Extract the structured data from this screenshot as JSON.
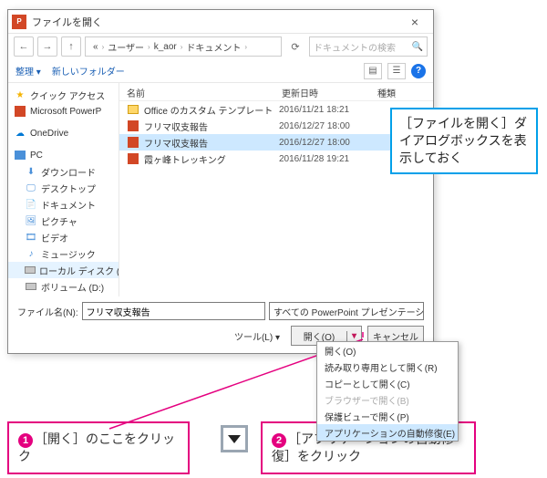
{
  "dialog": {
    "title": "ファイルを開く",
    "close_x": "×",
    "nav": {
      "back": "←",
      "fwd": "→",
      "up": "↑",
      "refresh": "⟳",
      "breadcrumb": [
        "«",
        "ユーザー",
        "k_aor",
        "ドキュメント"
      ],
      "search_placeholder": "ドキュメントの検索",
      "search_icon": "🔍"
    },
    "toolbar": {
      "organize": "整理 ▾",
      "newfolder": "新しいフォルダー",
      "help": "?"
    },
    "columns": {
      "name": "名前",
      "date": "更新日時",
      "type": "種類"
    },
    "sidebar": [
      {
        "icon": "star",
        "label": "クイック アクセス",
        "color": "#3a7bd5"
      },
      {
        "icon": "ppt",
        "label": "Microsoft PowerP",
        "color": "#d24726"
      },
      {
        "icon": "od",
        "label": "OneDrive",
        "color": "#0078d4"
      },
      {
        "icon": "pc",
        "label": "PC",
        "color": "#4a90d9"
      },
      {
        "icon": "dl",
        "label": "ダウンロード",
        "color": "#4a90d9"
      },
      {
        "icon": "desk",
        "label": "デスクトップ",
        "color": "#5aa9e6"
      },
      {
        "icon": "doc",
        "label": "ドキュメント",
        "color": "#4a90d9"
      },
      {
        "icon": "pic",
        "label": "ピクチャ",
        "color": "#4a90d9"
      },
      {
        "icon": "vid",
        "label": "ビデオ",
        "color": "#4a90d9"
      },
      {
        "icon": "mus",
        "label": "ミュージック",
        "color": "#4a90d9"
      },
      {
        "icon": "drive",
        "label": "ローカル ディスク (C",
        "color": "#888",
        "selected": true
      },
      {
        "icon": "drive",
        "label": "ボリューム (D:)",
        "color": "#888"
      }
    ],
    "files": [
      {
        "icon": "folder",
        "name": "Office のカスタム テンプレート",
        "date": "2016/11/21 18:21"
      },
      {
        "icon": "ppt",
        "name": "フリマ収支報告",
        "date": "2016/12/27 18:00"
      },
      {
        "icon": "ppt",
        "name": "フリマ収支報告",
        "date": "2016/12/27 18:00",
        "selected": true
      },
      {
        "icon": "ppt",
        "name": "霞ヶ峰トレッキング",
        "date": "2016/11/28 19:21"
      }
    ],
    "footer": {
      "fname_label": "ファイル名(N):",
      "fname_value": "フリマ収支報告",
      "filetype": "すべての PowerPoint プレゼンテーシ",
      "tools": "ツール(L)  ▾",
      "open": "開く(O)",
      "open_dd": "▾",
      "cancel": "キャンセル"
    }
  },
  "menu": [
    {
      "label": "開く(O)"
    },
    {
      "label": "読み取り専用として開く(R)"
    },
    {
      "label": "コピーとして開く(C)"
    },
    {
      "label": "ブラウザーで開く(B)",
      "disabled": true
    },
    {
      "label": "保護ビューで開く(P)"
    },
    {
      "label": "アプリケーションの自動修復(E)",
      "selected": true
    }
  ],
  "callouts": {
    "blue": "［ファイルを開く］ダイアログボックスを表示しておく",
    "pink1_num": "1",
    "pink1": "［開く］のここをクリック",
    "pink2_num": "2",
    "pink2": "［アプリケーションの自動修復］をクリック"
  }
}
